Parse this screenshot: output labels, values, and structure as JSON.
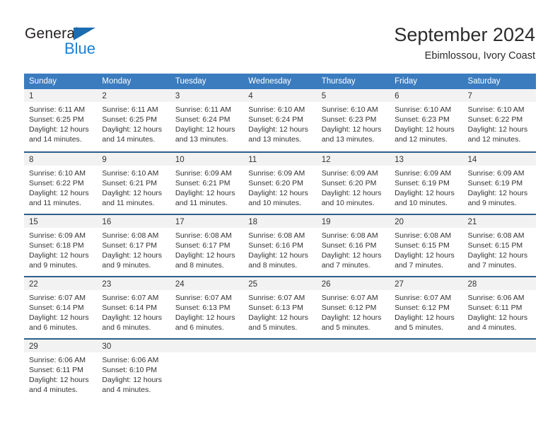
{
  "brand": {
    "name_part1": "General",
    "name_part2": "Blue",
    "triangle_icon": "triangle-icon",
    "color_dark": "#231f20",
    "color_blue": "#1b7fd4"
  },
  "header": {
    "title": "September 2024",
    "subtitle": "Ebimlossou, Ivory Coast"
  },
  "calendar": {
    "header_color": "#3b7cbf",
    "separator_color": "#2e5f8a",
    "day_band_color": "#f2f2f2",
    "weekdays": [
      "Sunday",
      "Monday",
      "Tuesday",
      "Wednesday",
      "Thursday",
      "Friday",
      "Saturday"
    ],
    "weeks": [
      [
        {
          "day": "1",
          "sunrise": "Sunrise: 6:11 AM",
          "sunset": "Sunset: 6:25 PM",
          "daylight_1": "Daylight: 12 hours",
          "daylight_2": "and 14 minutes."
        },
        {
          "day": "2",
          "sunrise": "Sunrise: 6:11 AM",
          "sunset": "Sunset: 6:25 PM",
          "daylight_1": "Daylight: 12 hours",
          "daylight_2": "and 14 minutes."
        },
        {
          "day": "3",
          "sunrise": "Sunrise: 6:11 AM",
          "sunset": "Sunset: 6:24 PM",
          "daylight_1": "Daylight: 12 hours",
          "daylight_2": "and 13 minutes."
        },
        {
          "day": "4",
          "sunrise": "Sunrise: 6:10 AM",
          "sunset": "Sunset: 6:24 PM",
          "daylight_1": "Daylight: 12 hours",
          "daylight_2": "and 13 minutes."
        },
        {
          "day": "5",
          "sunrise": "Sunrise: 6:10 AM",
          "sunset": "Sunset: 6:23 PM",
          "daylight_1": "Daylight: 12 hours",
          "daylight_2": "and 13 minutes."
        },
        {
          "day": "6",
          "sunrise": "Sunrise: 6:10 AM",
          "sunset": "Sunset: 6:23 PM",
          "daylight_1": "Daylight: 12 hours",
          "daylight_2": "and 12 minutes."
        },
        {
          "day": "7",
          "sunrise": "Sunrise: 6:10 AM",
          "sunset": "Sunset: 6:22 PM",
          "daylight_1": "Daylight: 12 hours",
          "daylight_2": "and 12 minutes."
        }
      ],
      [
        {
          "day": "8",
          "sunrise": "Sunrise: 6:10 AM",
          "sunset": "Sunset: 6:22 PM",
          "daylight_1": "Daylight: 12 hours",
          "daylight_2": "and 11 minutes."
        },
        {
          "day": "9",
          "sunrise": "Sunrise: 6:10 AM",
          "sunset": "Sunset: 6:21 PM",
          "daylight_1": "Daylight: 12 hours",
          "daylight_2": "and 11 minutes."
        },
        {
          "day": "10",
          "sunrise": "Sunrise: 6:09 AM",
          "sunset": "Sunset: 6:21 PM",
          "daylight_1": "Daylight: 12 hours",
          "daylight_2": "and 11 minutes."
        },
        {
          "day": "11",
          "sunrise": "Sunrise: 6:09 AM",
          "sunset": "Sunset: 6:20 PM",
          "daylight_1": "Daylight: 12 hours",
          "daylight_2": "and 10 minutes."
        },
        {
          "day": "12",
          "sunrise": "Sunrise: 6:09 AM",
          "sunset": "Sunset: 6:20 PM",
          "daylight_1": "Daylight: 12 hours",
          "daylight_2": "and 10 minutes."
        },
        {
          "day": "13",
          "sunrise": "Sunrise: 6:09 AM",
          "sunset": "Sunset: 6:19 PM",
          "daylight_1": "Daylight: 12 hours",
          "daylight_2": "and 10 minutes."
        },
        {
          "day": "14",
          "sunrise": "Sunrise: 6:09 AM",
          "sunset": "Sunset: 6:19 PM",
          "daylight_1": "Daylight: 12 hours",
          "daylight_2": "and 9 minutes."
        }
      ],
      [
        {
          "day": "15",
          "sunrise": "Sunrise: 6:09 AM",
          "sunset": "Sunset: 6:18 PM",
          "daylight_1": "Daylight: 12 hours",
          "daylight_2": "and 9 minutes."
        },
        {
          "day": "16",
          "sunrise": "Sunrise: 6:08 AM",
          "sunset": "Sunset: 6:17 PM",
          "daylight_1": "Daylight: 12 hours",
          "daylight_2": "and 9 minutes."
        },
        {
          "day": "17",
          "sunrise": "Sunrise: 6:08 AM",
          "sunset": "Sunset: 6:17 PM",
          "daylight_1": "Daylight: 12 hours",
          "daylight_2": "and 8 minutes."
        },
        {
          "day": "18",
          "sunrise": "Sunrise: 6:08 AM",
          "sunset": "Sunset: 6:16 PM",
          "daylight_1": "Daylight: 12 hours",
          "daylight_2": "and 8 minutes."
        },
        {
          "day": "19",
          "sunrise": "Sunrise: 6:08 AM",
          "sunset": "Sunset: 6:16 PM",
          "daylight_1": "Daylight: 12 hours",
          "daylight_2": "and 7 minutes."
        },
        {
          "day": "20",
          "sunrise": "Sunrise: 6:08 AM",
          "sunset": "Sunset: 6:15 PM",
          "daylight_1": "Daylight: 12 hours",
          "daylight_2": "and 7 minutes."
        },
        {
          "day": "21",
          "sunrise": "Sunrise: 6:08 AM",
          "sunset": "Sunset: 6:15 PM",
          "daylight_1": "Daylight: 12 hours",
          "daylight_2": "and 7 minutes."
        }
      ],
      [
        {
          "day": "22",
          "sunrise": "Sunrise: 6:07 AM",
          "sunset": "Sunset: 6:14 PM",
          "daylight_1": "Daylight: 12 hours",
          "daylight_2": "and 6 minutes."
        },
        {
          "day": "23",
          "sunrise": "Sunrise: 6:07 AM",
          "sunset": "Sunset: 6:14 PM",
          "daylight_1": "Daylight: 12 hours",
          "daylight_2": "and 6 minutes."
        },
        {
          "day": "24",
          "sunrise": "Sunrise: 6:07 AM",
          "sunset": "Sunset: 6:13 PM",
          "daylight_1": "Daylight: 12 hours",
          "daylight_2": "and 6 minutes."
        },
        {
          "day": "25",
          "sunrise": "Sunrise: 6:07 AM",
          "sunset": "Sunset: 6:13 PM",
          "daylight_1": "Daylight: 12 hours",
          "daylight_2": "and 5 minutes."
        },
        {
          "day": "26",
          "sunrise": "Sunrise: 6:07 AM",
          "sunset": "Sunset: 6:12 PM",
          "daylight_1": "Daylight: 12 hours",
          "daylight_2": "and 5 minutes."
        },
        {
          "day": "27",
          "sunrise": "Sunrise: 6:07 AM",
          "sunset": "Sunset: 6:12 PM",
          "daylight_1": "Daylight: 12 hours",
          "daylight_2": "and 5 minutes."
        },
        {
          "day": "28",
          "sunrise": "Sunrise: 6:06 AM",
          "sunset": "Sunset: 6:11 PM",
          "daylight_1": "Daylight: 12 hours",
          "daylight_2": "and 4 minutes."
        }
      ],
      [
        {
          "day": "29",
          "sunrise": "Sunrise: 6:06 AM",
          "sunset": "Sunset: 6:11 PM",
          "daylight_1": "Daylight: 12 hours",
          "daylight_2": "and 4 minutes."
        },
        {
          "day": "30",
          "sunrise": "Sunrise: 6:06 AM",
          "sunset": "Sunset: 6:10 PM",
          "daylight_1": "Daylight: 12 hours",
          "daylight_2": "and 4 minutes."
        },
        {
          "day": "",
          "sunrise": "",
          "sunset": "",
          "daylight_1": "",
          "daylight_2": ""
        },
        {
          "day": "",
          "sunrise": "",
          "sunset": "",
          "daylight_1": "",
          "daylight_2": ""
        },
        {
          "day": "",
          "sunrise": "",
          "sunset": "",
          "daylight_1": "",
          "daylight_2": ""
        },
        {
          "day": "",
          "sunrise": "",
          "sunset": "",
          "daylight_1": "",
          "daylight_2": ""
        },
        {
          "day": "",
          "sunrise": "",
          "sunset": "",
          "daylight_1": "",
          "daylight_2": ""
        }
      ]
    ]
  }
}
